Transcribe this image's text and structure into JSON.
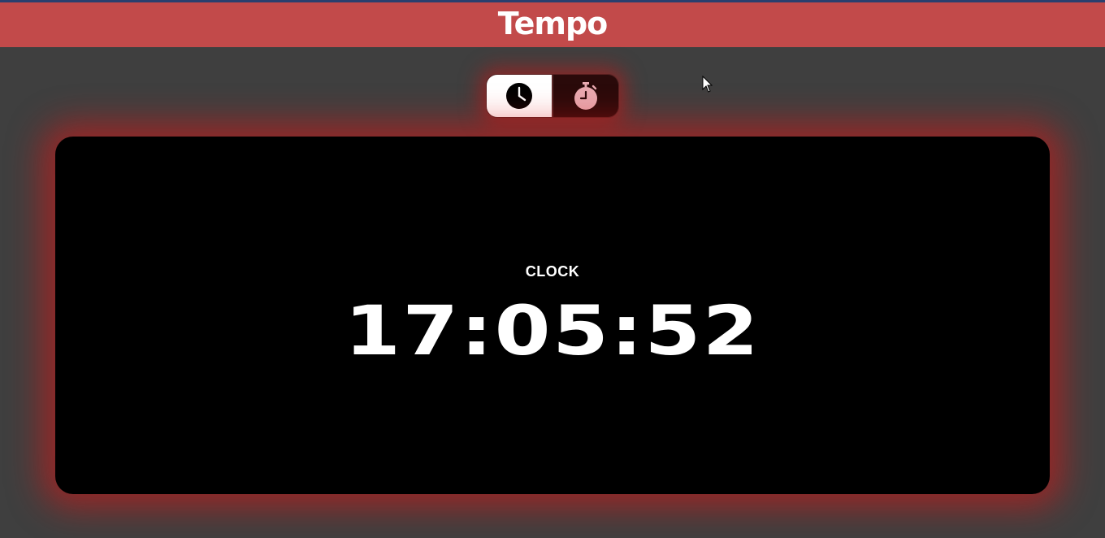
{
  "app": {
    "title": "Tempo"
  },
  "mode_toggle": {
    "options": [
      {
        "name": "clock",
        "icon": "clock-icon",
        "active": true
      },
      {
        "name": "stopwatch",
        "icon": "stopwatch-icon",
        "active": false
      }
    ]
  },
  "display": {
    "mode_label": "CLOCK",
    "time": "17:05:52"
  },
  "colors": {
    "header_bg": "#c24a4a",
    "page_bg": "#3f3f3f",
    "panel_bg": "#000000",
    "glow": "#dc1414",
    "stopwatch_icon": "#e8a9b0"
  }
}
